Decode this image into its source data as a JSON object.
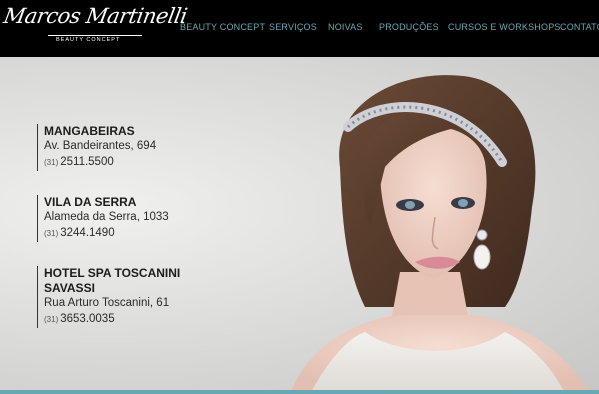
{
  "brand": {
    "name": "Marcos Martinelli",
    "tagline": "BEAUTY CONCEPT"
  },
  "nav": {
    "items": [
      {
        "label": "BEAUTY CONCEPT"
      },
      {
        "label": "SERVIÇOS"
      },
      {
        "label": "NOIVAS"
      },
      {
        "label": "PRODUÇÕES"
      },
      {
        "label": "CURSOS E WORKSHOPS"
      },
      {
        "label": "CONTATO"
      }
    ]
  },
  "locations": [
    {
      "name": "MANGABEIRAS",
      "address": "Av. Bandeirantes, 694",
      "ddd": "(31)",
      "phone": "2511.5500"
    },
    {
      "name": "VILA DA SERRA",
      "address": "Alameda da Serra, 1033",
      "ddd": "(31)",
      "phone": "3244.1490"
    },
    {
      "name_line1": "HOTEL SPA TOSCANINI",
      "name_line2": "SAVASSI",
      "address": "Rua Arturo Toscanini, 61",
      "ddd": "(31)",
      "phone": "3653.0035"
    }
  ],
  "colors": {
    "header_bg": "#000000",
    "nav_text": "#6aa7b3",
    "accent_bar": "#6aa7b3"
  }
}
